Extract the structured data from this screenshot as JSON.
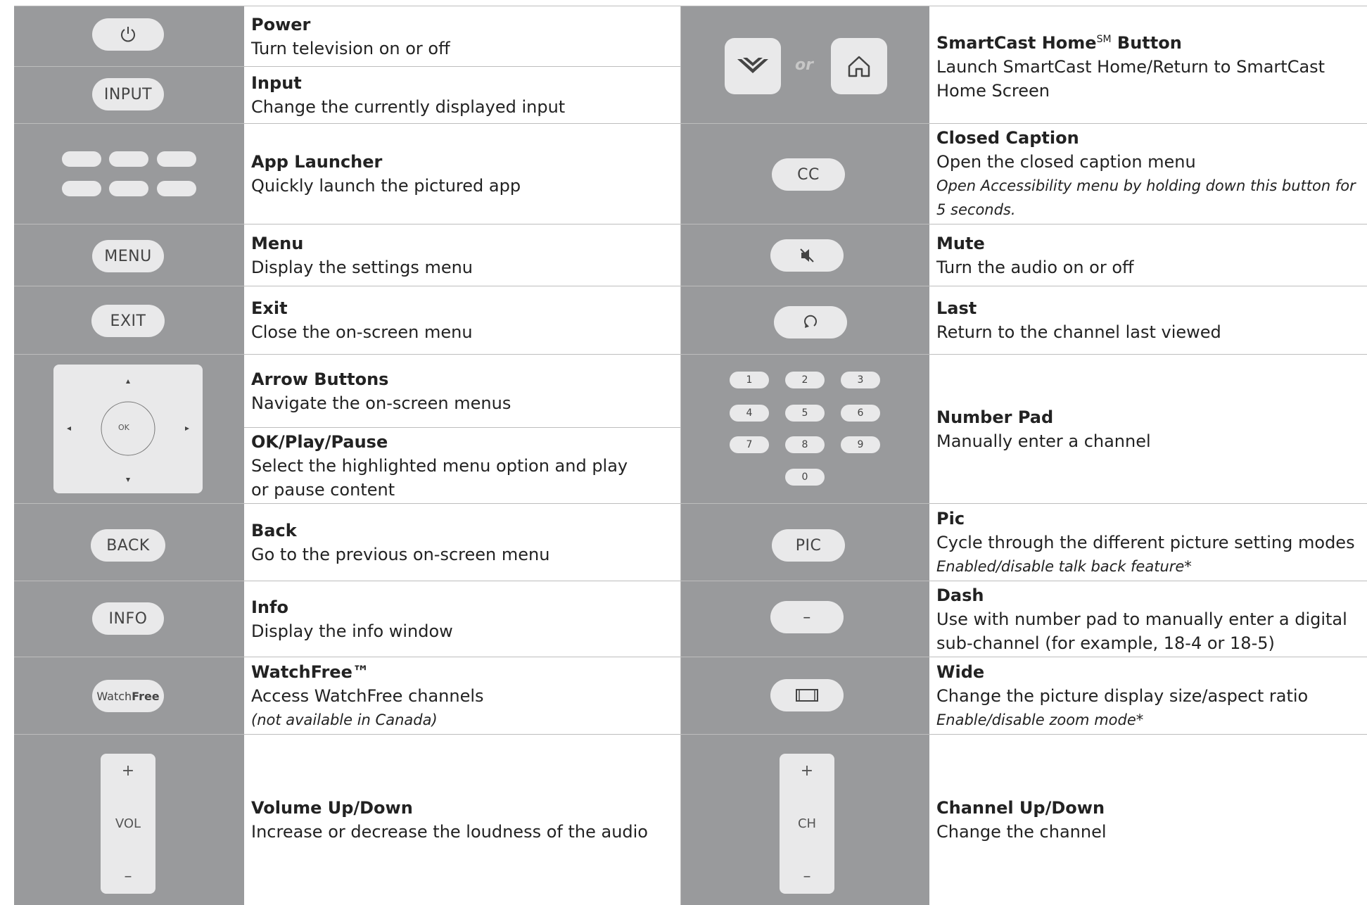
{
  "left": [
    {
      "title": "Power",
      "desc": "Turn television on or off",
      "btn": "power-icon"
    },
    {
      "title": "Input",
      "desc": "Change the currently displayed input",
      "btn": "INPUT"
    },
    {
      "title": "App Launcher",
      "desc": "Quickly launch the pictured app"
    },
    {
      "title": "Menu",
      "desc": "Display the settings menu",
      "btn": "MENU"
    },
    {
      "title": "Exit",
      "desc": "Close the on-screen menu",
      "btn": "EXIT"
    },
    {
      "title": "Arrow Buttons",
      "desc": "Navigate the on-screen menus"
    },
    {
      "title": "OK/Play/Pause",
      "desc": "Select the highlighted menu option and play or pause content",
      "btn": "OK"
    },
    {
      "title": "Back",
      "desc": "Go to the previous on-screen menu",
      "btn": "BACK"
    },
    {
      "title": "Info",
      "desc": "Display the info window",
      "btn": "INFO"
    },
    {
      "title": "WatchFree™",
      "desc": "Access WatchFree channels",
      "note": "(not available in Canada)",
      "btn_a": "Watch",
      "btn_b": "Free"
    },
    {
      "title": "Volume Up/Down",
      "desc": "Increase or decrease the loudness of the audio",
      "btn_plus": "+",
      "btn": "VOL",
      "btn_minus": "–"
    }
  ],
  "right": [
    {
      "title": "SmartCast Home",
      "sup": "SM",
      "title_b": " Button",
      "desc": "Launch SmartCast Home/Return to SmartCast Home Screen",
      "or": "or"
    },
    {
      "title": "Closed Caption",
      "desc": "Open the closed caption menu",
      "note": "Open Accessibility menu by holding down this button for 5 seconds.",
      "btn": "CC"
    },
    {
      "title": "Mute",
      "desc": "Turn the audio on or off",
      "btn": "mute-icon"
    },
    {
      "title": "Last",
      "desc": "Return to the channel last viewed",
      "btn": "last-icon"
    },
    {
      "title": "Number Pad",
      "desc": "Manually enter a channel",
      "keys": [
        "1",
        "2",
        "3",
        "4",
        "5",
        "6",
        "7",
        "8",
        "9",
        "0"
      ]
    },
    {
      "title": "Pic",
      "desc": "Cycle through the different picture setting modes",
      "note": "Enabled/disable talk back feature*",
      "btn": "PIC"
    },
    {
      "title": "Dash",
      "desc": "Use with number pad to manually enter a digital sub-channel (for example, 18-4 or 18-5)",
      "btn": "–"
    },
    {
      "title": "Wide",
      "desc": "Change the picture display size/aspect ratio",
      "note": "Enable/disable zoom mode*",
      "btn": "wide-icon"
    },
    {
      "title": "Channel Up/Down",
      "desc": "Change the channel",
      "btn_plus": "+",
      "btn": "CH",
      "btn_minus": "–"
    }
  ]
}
